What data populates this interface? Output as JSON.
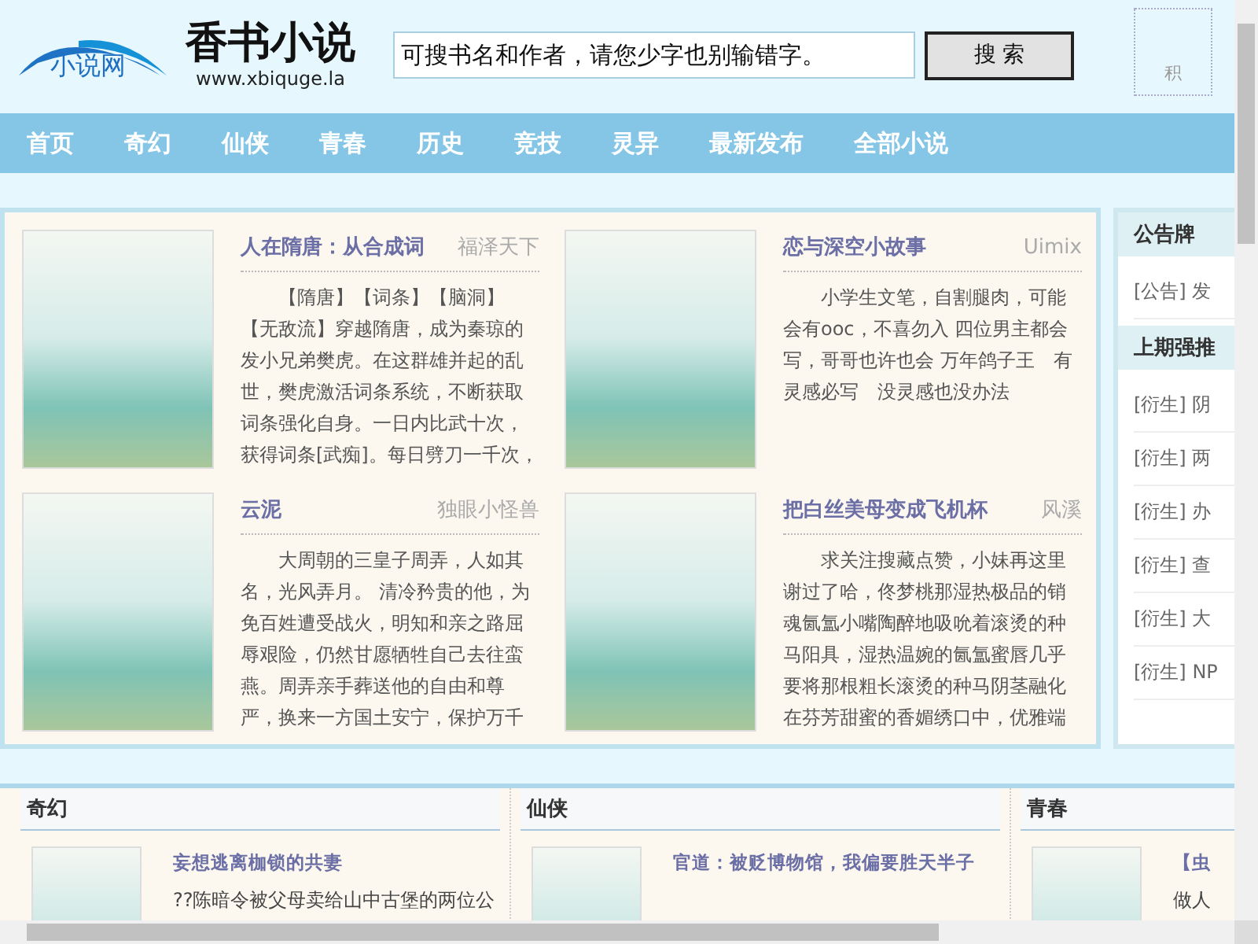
{
  "header": {
    "logo_text": "小说网",
    "site_name": "香书小说",
    "site_url": "www.xbiquge.la",
    "search": {
      "placeholder": "可搜书名和作者，请您少字也别输错字。"
    },
    "search_button": "搜 索",
    "side_box_text": "积"
  },
  "nav": [
    {
      "label": "首页"
    },
    {
      "label": "奇幻"
    },
    {
      "label": "仙侠"
    },
    {
      "label": "青春"
    },
    {
      "label": "历史"
    },
    {
      "label": "竞技"
    },
    {
      "label": "灵异"
    },
    {
      "label": "最新发布"
    },
    {
      "label": "全部小说"
    }
  ],
  "featured": [
    {
      "title": "人在隋唐：从合成词",
      "author": "福泽天下",
      "description": "【隋唐】【词条】【脑洞】【无敌流】穿越隋唐，成为秦琼的发小兄弟樊虎。在这群雄并起的乱世，樊虎激活词条系统，不断获取词条强化自身。一日内比武十次，获得词条[武痴]。每日劈刀一千次，"
    },
    {
      "title": "恋与深空小故事",
      "author": "Uimix",
      "description": "小学生文笔，自割腿肉，可能会有ooc，不喜勿入 四位男主都会写，哥哥也许也会 万年鸽子王　有灵感必写　没灵感也没办法"
    },
    {
      "title": "云泥",
      "author": "独眼小怪兽",
      "description": "大周朝的三皇子周弄，人如其名，光风弄月。 清冷矜贵的他，为免百姓遭受战火，明知和亲之路屈辱艰险，仍然甘愿牺牲自己去往蛮燕。周弄亲手葬送他的自由和尊严，换来一方国土安宁，保护万千"
    },
    {
      "title": "把白丝美母变成飞机杯",
      "author": "风溪",
      "description": "求关注搜藏点赞，小妹再这里谢过了哈，佟梦桃那湿热极品的销魂氤氲小嘴陶醉地吸吮着滚烫的种马阳具，湿热温婉的氤氲蜜唇几乎要将那根粗长滚烫的种马阴茎融化在芬芳甜蜜的香媚绣口中，优雅端"
    }
  ],
  "sidebar": [
    {
      "title": "公告牌",
      "items": [
        {
          "tag": "[公告]",
          "text": "发"
        }
      ]
    },
    {
      "title": "上期强推",
      "items": [
        {
          "tag": "[衍生]",
          "text": "阴"
        },
        {
          "tag": "[衍生]",
          "text": "两"
        },
        {
          "tag": "[衍生]",
          "text": "办"
        },
        {
          "tag": "[衍生]",
          "text": "查"
        },
        {
          "tag": "[衍生]",
          "text": "大"
        },
        {
          "tag": "[衍生]",
          "text": "NP"
        }
      ]
    }
  ],
  "categories": [
    {
      "title": "奇幻",
      "book": {
        "title": "妄想逃离枷锁的共妻",
        "description": "??陈暗令被父母卖给山中古堡的两位公"
      }
    },
    {
      "title": "仙侠",
      "book": {
        "title": "官道：被贬博物馆，我偏要胜天半子"
      }
    },
    {
      "title": "青春",
      "book": {
        "title": "【虫",
        "description": "做人"
      }
    }
  ]
}
